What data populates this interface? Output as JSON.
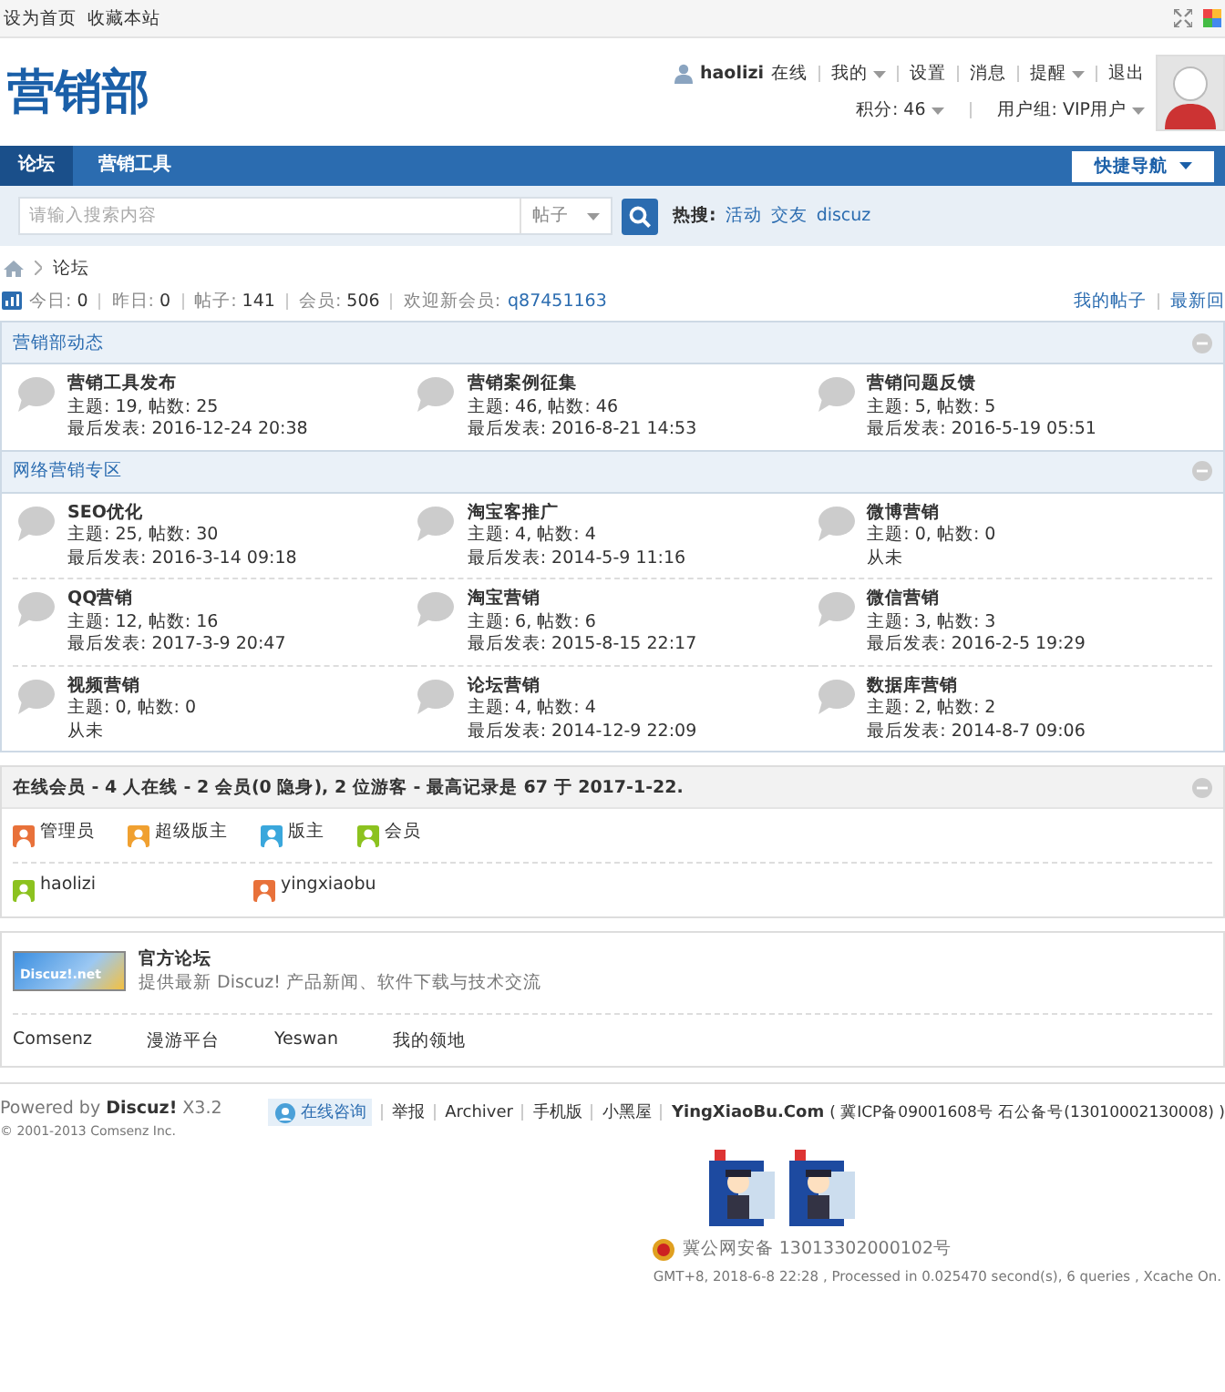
{
  "topbar": {
    "links": [
      "设为首页",
      "收藏本站"
    ]
  },
  "header": {
    "logo": "营销部",
    "user": {
      "name": "haolizi",
      "status": "在线"
    },
    "menu": [
      {
        "label": "我的",
        "dropdown": true
      },
      {
        "label": "设置",
        "dropdown": false
      },
      {
        "label": "消息",
        "dropdown": false
      },
      {
        "label": "提醒",
        "dropdown": true
      },
      {
        "label": "退出",
        "dropdown": false
      }
    ],
    "credits": "积分: 46",
    "group": "用户组: VIP用户"
  },
  "nav": {
    "tabs": [
      {
        "label": "论坛",
        "selected": true
      },
      {
        "label": "营销工具",
        "selected": false
      }
    ],
    "quick_nav": "快捷导航"
  },
  "search": {
    "placeholder": "请输入搜索内容",
    "type": "帖子",
    "hot_label": "热搜:",
    "hot": [
      "活动",
      "交友",
      "discuz"
    ]
  },
  "breadcrumb": [
    "论坛"
  ],
  "stats": {
    "items": [
      {
        "label": "今日:",
        "value": "0"
      },
      {
        "label": "昨日:",
        "value": "0"
      },
      {
        "label": "帖子:",
        "value": "141"
      },
      {
        "label": "会员:",
        "value": "506"
      }
    ],
    "new_member_label": "欢迎新会员:",
    "new_member": "q87451163",
    "links": [
      "我的帖子",
      "最新回"
    ]
  },
  "categories": [
    {
      "title": "营销部动态",
      "forums": [
        {
          "name": "营销工具发布",
          "stats": "主题: 19, 帖数: 25",
          "last": "最后发表: 2016-12-24 20:38"
        },
        {
          "name": "营销案例征集",
          "stats": "主题: 46, 帖数: 46",
          "last": "最后发表: 2016-8-21 14:53"
        },
        {
          "name": "营销问题反馈",
          "stats": "主题: 5, 帖数: 5",
          "last": "最后发表: 2016-5-19 05:51"
        }
      ]
    },
    {
      "title": "网络营销专区",
      "forums": [
        {
          "name": "SEO优化",
          "stats": "主题: 25, 帖数: 30",
          "last": "最后发表: 2016-3-14 09:18"
        },
        {
          "name": "淘宝客推广",
          "stats": "主题: 4, 帖数: 4",
          "last": "最后发表: 2014-5-9 11:16"
        },
        {
          "name": "微博营销",
          "stats": "主题: 0, 帖数: 0",
          "last": "从未"
        },
        {
          "name": "QQ营销",
          "stats": "主题: 12, 帖数: 16",
          "last": "最后发表: 2017-3-9 20:47"
        },
        {
          "name": "淘宝营销",
          "stats": "主题: 6, 帖数: 6",
          "last": "最后发表: 2015-8-15 22:17"
        },
        {
          "name": "微信营销",
          "stats": "主题: 3, 帖数: 3",
          "last": "最后发表: 2016-2-5 19:29"
        },
        {
          "name": "视频营销",
          "stats": "主题: 0, 帖数: 0",
          "last": "从未"
        },
        {
          "name": "论坛营销",
          "stats": "主题: 4, 帖数: 4",
          "last": "最后发表: 2014-12-9 22:09"
        },
        {
          "name": "数据库营销",
          "stats": "主题: 2, 帖数: 2",
          "last": "最后发表: 2014-8-7 09:06"
        }
      ]
    }
  ],
  "online": {
    "title": "在线会员 - 4 人在线 - 2 会员(0 隐身), 2 位游客 - 最高记录是 67 于 2017-1-22.",
    "legend": [
      {
        "label": "管理员",
        "color": "#e8713a"
      },
      {
        "label": "超级版主",
        "color": "#f0a030"
      },
      {
        "label": "版主",
        "color": "#3aa7dc"
      },
      {
        "label": "会员",
        "color": "#8cc21f"
      }
    ],
    "users": [
      {
        "name": "haolizi",
        "color": "#8cc21f"
      },
      {
        "name": "yingxiaobu",
        "color": "#e8713a"
      }
    ]
  },
  "friend_links": {
    "featured": {
      "logo": "Discuz!.net",
      "title": "官方论坛",
      "desc": "提供最新 Discuz! 产品新闻、软件下载与技术交流"
    },
    "links": [
      "Comsenz",
      "漫游平台",
      "Yeswan",
      "我的领地"
    ]
  },
  "footer": {
    "powered": "Powered by **Discuz!** X3.2",
    "copyright": "© 2001-2013 Comsenz Inc.",
    "consult": "在线咨询",
    "links": [
      "举报",
      "Archiver",
      "手机版",
      "小黑屋"
    ],
    "site": "YingXiaoBu.Com",
    "icp": "( 冀ICP备09001608号 石公备号(13010002130008) )",
    "police": "冀公网安备 13013302000102号",
    "info": "GMT+8, 2018-6-8 22:28 , Processed in 0.025470 second(s), 6 queries , Xcache On."
  }
}
